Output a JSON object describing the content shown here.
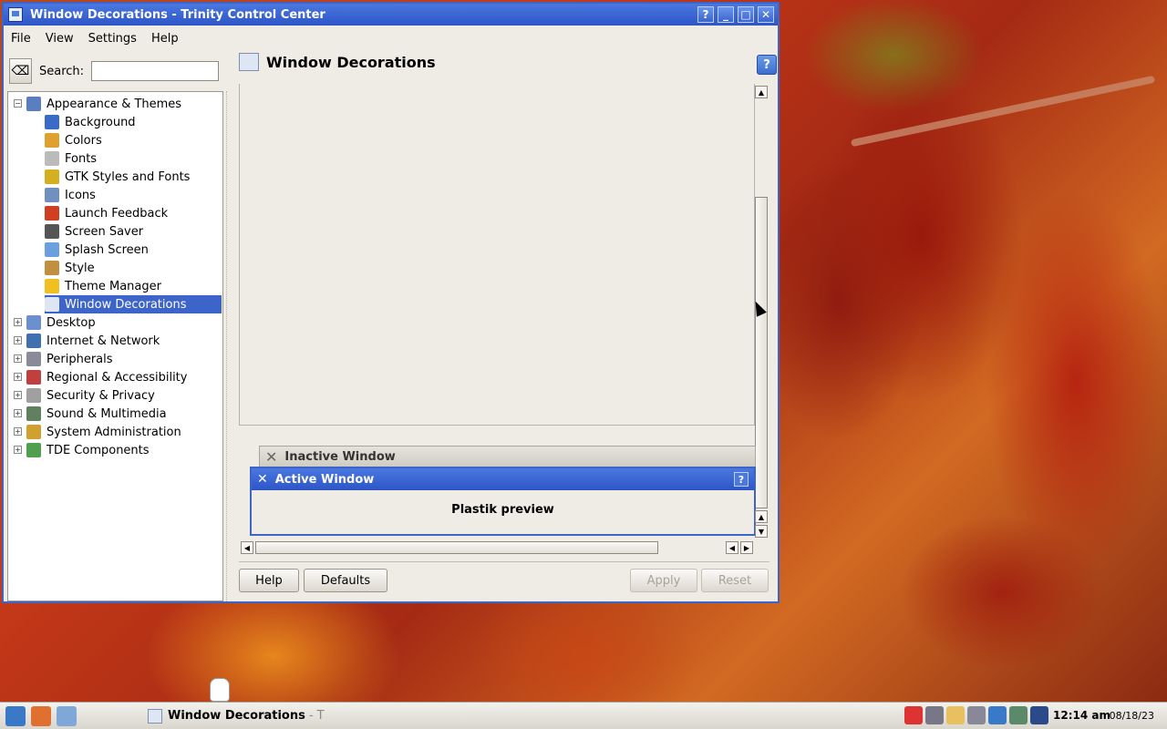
{
  "window": {
    "title": "Window Decorations - Trinity Control Center",
    "controls": {
      "help": "?",
      "minimize": "_",
      "maximize": "□",
      "close": "✕"
    }
  },
  "menubar": {
    "items": [
      "File",
      "View",
      "Settings",
      "Help"
    ]
  },
  "search": {
    "label": "Search:",
    "value": ""
  },
  "tree": {
    "items": [
      {
        "label": "Appearance & Themes",
        "level": 0,
        "expander": "−",
        "color": "#5a7fc0"
      },
      {
        "label": "Background",
        "level": 1,
        "color": "#3a6bc8"
      },
      {
        "label": "Colors",
        "level": 1,
        "color": "#e0a030"
      },
      {
        "label": "Fonts",
        "level": 1,
        "color": "#bbbbbb"
      },
      {
        "label": "GTK Styles and Fonts",
        "level": 1,
        "color": "#d4b020"
      },
      {
        "label": "Icons",
        "level": 1,
        "color": "#7090c0"
      },
      {
        "label": "Launch Feedback",
        "level": 1,
        "color": "#d04020"
      },
      {
        "label": "Screen Saver",
        "level": 1,
        "color": "#555555"
      },
      {
        "label": "Splash Screen",
        "level": 1,
        "color": "#6aa0e0"
      },
      {
        "label": "Style",
        "level": 1,
        "color": "#c09040"
      },
      {
        "label": "Theme Manager",
        "level": 1,
        "color": "#f0c020"
      },
      {
        "label": "Window Decorations",
        "level": 1,
        "color": "#dfe6f3",
        "selected": true
      },
      {
        "label": "Desktop",
        "level": 0,
        "expander": "+",
        "color": "#6a90d0"
      },
      {
        "label": "Internet & Network",
        "level": 0,
        "expander": "+",
        "color": "#4070b0"
      },
      {
        "label": "Peripherals",
        "level": 0,
        "expander": "+",
        "color": "#8a8a9a"
      },
      {
        "label": "Regional & Accessibility",
        "level": 0,
        "expander": "+",
        "color": "#c04040"
      },
      {
        "label": "Security & Privacy",
        "level": 0,
        "expander": "+",
        "color": "#a0a0a0"
      },
      {
        "label": "Sound & Multimedia",
        "level": 0,
        "expander": "+",
        "color": "#608060"
      },
      {
        "label": "System Administration",
        "level": 0,
        "expander": "+",
        "color": "#d0a030"
      },
      {
        "label": "TDE Components",
        "level": 0,
        "expander": "+",
        "color": "#50a050"
      }
    ]
  },
  "panel": {
    "title": "Window Decorations",
    "help_icon": "?"
  },
  "preview": {
    "inactive_title": "Inactive Window",
    "active_title": "Active Window",
    "body_text": "Plastik preview",
    "help_glyph": "?"
  },
  "buttons": {
    "help": "Help",
    "defaults": "Defaults",
    "apply": "Apply",
    "reset": "Reset"
  },
  "taskbar": {
    "task_label": "Window Decorations",
    "task_suffix": "- T",
    "time": "12:14 am",
    "date": "08/18/23"
  }
}
